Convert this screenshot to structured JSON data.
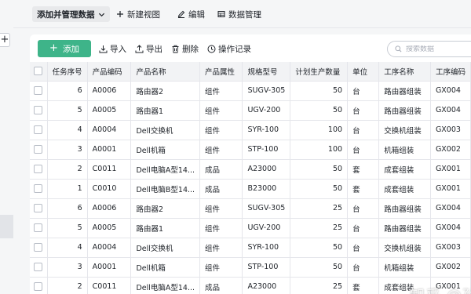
{
  "toolbar": {
    "items": [
      {
        "label": "添加并管理数据"
      },
      {
        "label": "新建视图"
      },
      {
        "label": "编辑"
      },
      {
        "label": "数据管理"
      }
    ]
  },
  "left_strip": {
    "plus": "+"
  },
  "actions": {
    "add": "添加",
    "import": "导入",
    "export": "导出",
    "delete": "删除",
    "log": "操作记录"
  },
  "search": {
    "placeholder": "搜索数据",
    "value": ""
  },
  "table": {
    "columns": [
      "任务序号",
      "产品编码",
      "产品名称",
      "产品属性",
      "规格型号",
      "计划生产数量",
      "单位",
      "工序名称",
      "工序编码"
    ],
    "rows": [
      [
        "6",
        "A0006",
        "路由器2",
        "组件",
        "SUGV-305",
        "50",
        "台",
        "路由器组装",
        "GX004"
      ],
      [
        "5",
        "A0005",
        "路由器1",
        "组件",
        "UGV-200",
        "50",
        "台",
        "路由器组装",
        "GX004"
      ],
      [
        "4",
        "A0004",
        "Dell交换机",
        "组件",
        "SYR-100",
        "100",
        "台",
        "交换机组装",
        "GX003"
      ],
      [
        "3",
        "A0001",
        "Dell机箱",
        "组件",
        "STP-100",
        "100",
        "台",
        "机箱组装",
        "GX002"
      ],
      [
        "2",
        "C0011",
        "Dell电脑A型14...",
        "成品",
        "A23000",
        "50",
        "套",
        "成套组装",
        "GX001"
      ],
      [
        "1",
        "C0010",
        "Dell电脑B型14...",
        "成品",
        "B23000",
        "50",
        "套",
        "成套组装",
        "GX001"
      ],
      [
        "6",
        "A0006",
        "路由器2",
        "组件",
        "SUGV-305",
        "25",
        "台",
        "路由器组装",
        "GX004"
      ],
      [
        "5",
        "A0005",
        "路由器1",
        "组件",
        "UGV-200",
        "25",
        "台",
        "路由器组装",
        "GX004"
      ],
      [
        "4",
        "A0004",
        "Dell交换机",
        "组件",
        "SYR-100",
        "50",
        "台",
        "交换机组装",
        "GX003"
      ],
      [
        "3",
        "A0001",
        "Dell机箱",
        "组件",
        "STP-100",
        "50",
        "台",
        "机箱组装",
        "GX002"
      ],
      [
        "2",
        "C0011",
        "Dell电脑A型14...",
        "成品",
        "A23000",
        "25",
        "套",
        "成套组装",
        "GX001"
      ]
    ]
  },
  "watermark": "知乎 @孙",
  "colors": {
    "accent": "#3eb489",
    "header_bg": "#f2f3f5",
    "border": "#e5e6eb"
  }
}
